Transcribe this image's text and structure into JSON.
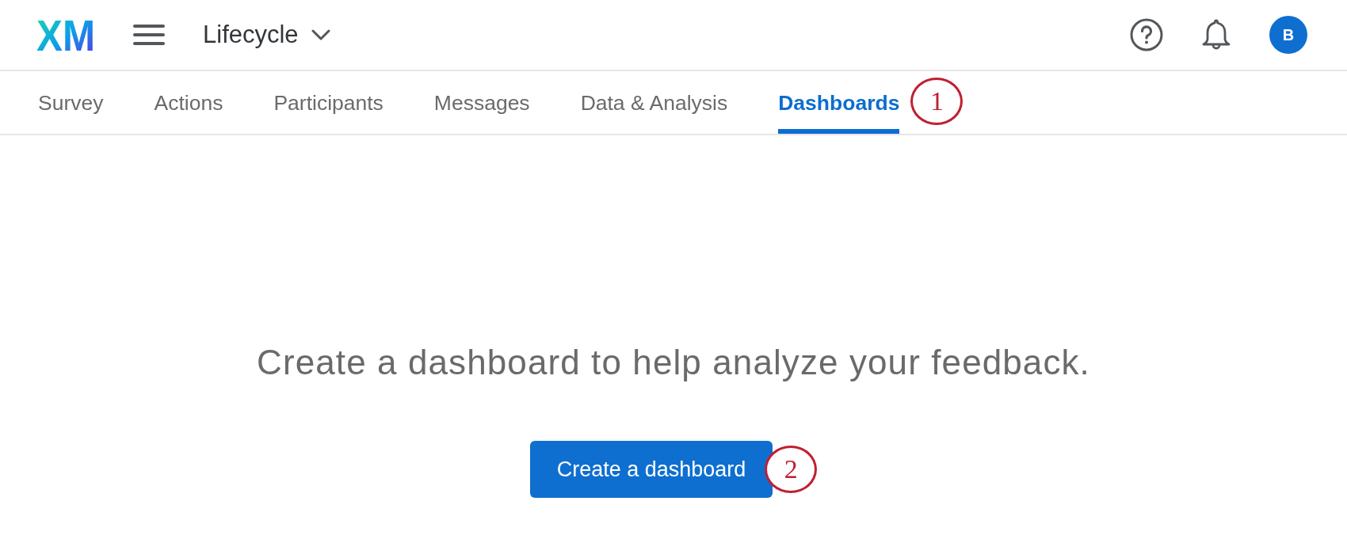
{
  "header": {
    "logo": "XM",
    "project": "Lifecycle",
    "avatar": "B"
  },
  "tabs": [
    {
      "label": "Survey",
      "selected": false
    },
    {
      "label": "Actions",
      "selected": false
    },
    {
      "label": "Participants",
      "selected": false
    },
    {
      "label": "Messages",
      "selected": false
    },
    {
      "label": "Data & Analysis",
      "selected": false
    },
    {
      "label": "Dashboards",
      "selected": true
    }
  ],
  "empty_state": {
    "message": "Create a dashboard to help analyze your feedback.",
    "button": "Create a dashboard"
  },
  "annotations": [
    {
      "label": "1"
    },
    {
      "label": "2"
    }
  ]
}
